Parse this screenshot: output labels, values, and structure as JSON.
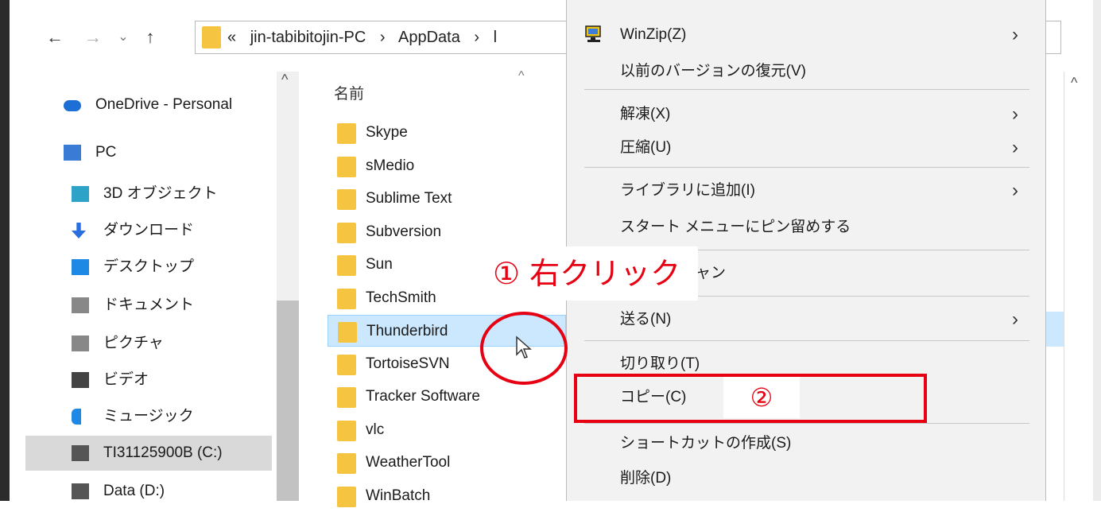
{
  "addressbar": {
    "crumbs": [
      "«",
      "jin-tabibitojin-PC",
      "›",
      "AppData",
      "›",
      "l"
    ]
  },
  "navigation": {
    "items": [
      {
        "label": "OneDrive - Personal",
        "icon": "cloud-icon",
        "color": "#1d6fd6"
      },
      {
        "label": "PC",
        "icon": "computer-icon",
        "color": "#3a7bd5"
      },
      {
        "label": "3D オブジェクト",
        "icon": "cube-icon",
        "color": "#2fa3c7"
      },
      {
        "label": "ダウンロード",
        "icon": "download-arrow-icon",
        "color": "#2a6ee0"
      },
      {
        "label": "デスクトップ",
        "icon": "desktop-icon",
        "color": "#1e88e5"
      },
      {
        "label": "ドキュメント",
        "icon": "document-icon",
        "color": "#888888"
      },
      {
        "label": "ピクチャ",
        "icon": "picture-icon",
        "color": "#888888"
      },
      {
        "label": "ビデオ",
        "icon": "film-icon",
        "color": "#444444"
      },
      {
        "label": "ミュージック",
        "icon": "music-note-icon",
        "color": "#1e88e5"
      },
      {
        "label": "TI31125900B (C:)",
        "icon": "drive-icon",
        "color": "#555555",
        "selected": true
      },
      {
        "label": "Data (D:)",
        "icon": "drive-icon",
        "color": "#555555"
      }
    ]
  },
  "files": {
    "column_header": "名前",
    "items": [
      {
        "name": "Skype"
      },
      {
        "name": "sMedio"
      },
      {
        "name": "Sublime Text"
      },
      {
        "name": "Subversion"
      },
      {
        "name": "Sun"
      },
      {
        "name": "TechSmith"
      },
      {
        "name": "Thunderbird",
        "selected": true
      },
      {
        "name": "TortoiseSVN"
      },
      {
        "name": "Tracker Software"
      },
      {
        "name": "vlc"
      },
      {
        "name": "WeatherTool"
      },
      {
        "name": "WinBatch"
      }
    ]
  },
  "context_menu": {
    "items": [
      {
        "label": "WinZip(Z)",
        "submenu": true,
        "icon": "winzip-icon"
      },
      {
        "label": "以前のバージョンの復元(V)"
      },
      {
        "separator": true
      },
      {
        "label": "解凍(X)",
        "submenu": true
      },
      {
        "label": "圧縮(U)",
        "submenu": true
      },
      {
        "separator": true
      },
      {
        "label": "ライブラリに追加(I)",
        "submenu": true
      },
      {
        "label": "スタート メニューにピン留めする"
      },
      {
        "separator": true
      },
      {
        "label": "脅威のスキャン"
      },
      {
        "separator": true
      },
      {
        "label": "送る(N)",
        "submenu": true
      },
      {
        "separator": true
      },
      {
        "label": "切り取り(T)"
      },
      {
        "label": "コピー(C)"
      },
      {
        "separator": true
      },
      {
        "label": "ショートカットの作成(S)"
      },
      {
        "label": "削除(D)"
      }
    ]
  },
  "annotations": {
    "step1": "① 右クリック",
    "step2": "②",
    "color": "#e60012"
  }
}
